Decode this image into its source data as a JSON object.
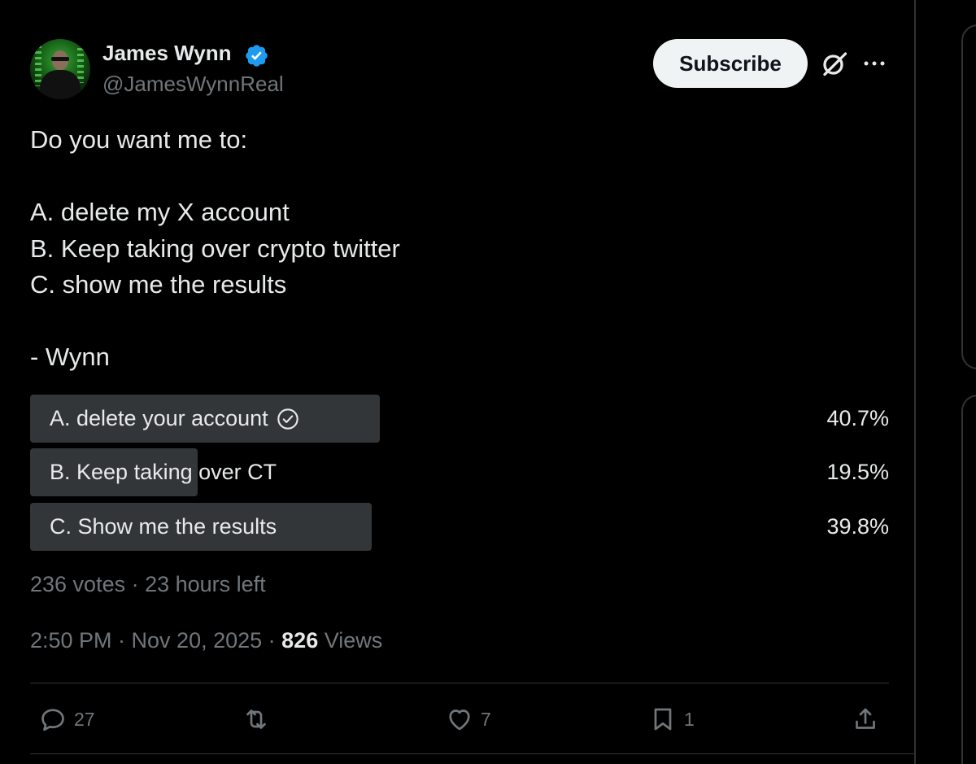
{
  "author": {
    "display_name": "James Wynn",
    "handle": "@JamesWynnReal",
    "verified_icon": "verified-badge-icon"
  },
  "header": {
    "subscribe_label": "Subscribe",
    "grok_icon": "grok-icon",
    "more_icon": "more-icon"
  },
  "tweet": {
    "text": "Do you want me to:\n\nA. delete my X account\nB. Keep taking over crypto twitter\nC. show me the results\n\n- Wynn"
  },
  "poll": {
    "options": [
      {
        "label": "A. delete your account",
        "percent": 40.7,
        "percent_label": "40.7%",
        "leading": true
      },
      {
        "label": "B. Keep taking over CT",
        "percent": 19.5,
        "percent_label": "19.5%",
        "leading": false
      },
      {
        "label": "C. Show me the results",
        "percent": 39.8,
        "percent_label": "39.8%",
        "leading": false
      }
    ],
    "meta": "236 votes · 23 hours left"
  },
  "timestamp": {
    "time_date": "2:50 PM · Nov 20, 2025 · ",
    "views_count": "826",
    "views_label": " Views"
  },
  "actions": {
    "replies": "27",
    "reposts": "",
    "likes": "7",
    "bookmarks": "1"
  },
  "colors": {
    "background": "#000000",
    "text": "#e7e9ea",
    "muted": "#71767b",
    "poll_fill": "#333639",
    "verified": "#1d9bf0"
  }
}
